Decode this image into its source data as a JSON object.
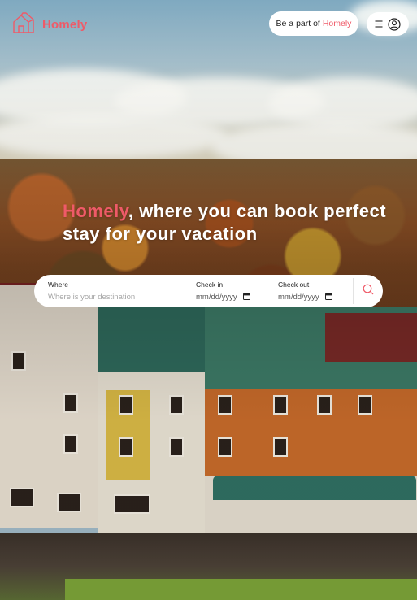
{
  "brand": {
    "name": "Homely",
    "accent_color": "#ef5a68",
    "logo_icon": "house-outline-icon"
  },
  "header": {
    "host_cta_prefix": "Be a part of",
    "host_cta_brand": "Homely",
    "menu_icon": "hamburger-icon",
    "profile_icon": "user-circle-icon"
  },
  "hero": {
    "accent_word": "Homely",
    "headline_rest": ", where you can book perfect stay for your vacation"
  },
  "search": {
    "where_label": "Where",
    "where_placeholder": "Where is your destination",
    "checkin_label": "Check in",
    "checkin_value": "mm/dd/yyyy",
    "checkout_label": "Check out",
    "checkout_value": "mm/dd/yyyy",
    "calendar_icon": "calendar-icon",
    "search_icon": "search-icon"
  }
}
